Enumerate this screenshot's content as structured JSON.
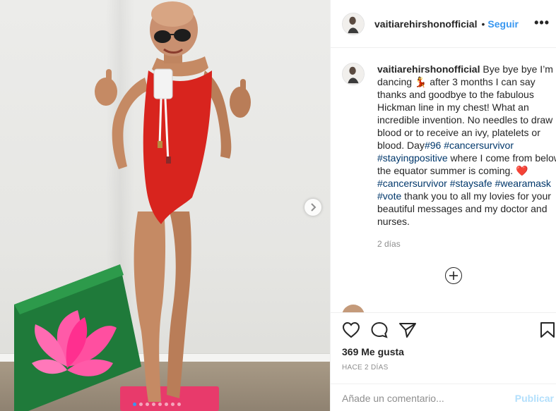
{
  "post": {
    "author": "vaitiarehirshonofficial",
    "header_separator": "•",
    "follow_label": "Seguir",
    "more_icon": "more-horizontal-icon",
    "caption": {
      "username": "vaitiarehirshonofficial",
      "part1": " Bye bye bye I’m dancing 💃 after 3 months I can say thanks and goodbye to the fabulous Hickman line in my chest! What an incredible invention. No needles to draw blood or to receive an ivy, platelets or blood. Day",
      "tag_day": "#96",
      "space1": " ",
      "tag_cancersurvivor": "#cancersurvivor",
      "space2": " ",
      "tag_stayingpositive": "#stayingpositive",
      "part2": " where I come from below the equator summer is coming. ❤️ ",
      "tag_cancersurvivor2": "#cancersurvivor",
      "space3": " ",
      "tag_staysafe": "#staysafe",
      "space4": " ",
      "tag_wearamask": "#wearamask",
      "space5": " ",
      "tag_vote": "#vote",
      "part3": " thank you to all my lovies for your beautiful messages and my doctor and nurses.",
      "time": "2 días"
    },
    "likes": "369 Me gusta",
    "posted": "HACE 2 DÍAS",
    "comment_placeholder": "Añade un comentario...",
    "publish_label": "Publicar",
    "carousel": {
      "slides": 8,
      "active_index": 0
    }
  },
  "colors": {
    "link_blue": "#3897f0",
    "hashtag": "#00376b",
    "muted": "#8e8e8e",
    "publish_disabled": "#b2dffc",
    "swimsuit_red": "#d8241e"
  },
  "icons": [
    "heart-icon",
    "comment-icon",
    "share-icon",
    "bookmark-icon",
    "add-circle-icon",
    "chevron-right-icon"
  ]
}
